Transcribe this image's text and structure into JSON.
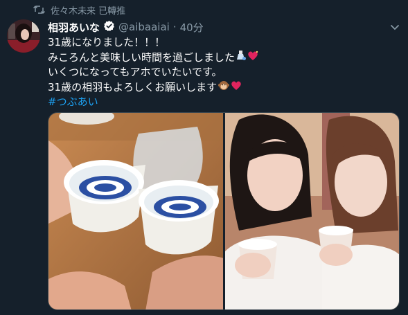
{
  "retweet": {
    "text": "佐々木未来 已轉推",
    "icon": "retweet-icon"
  },
  "author": {
    "display_name": "相羽あいな",
    "handle": "@aibaaiai",
    "separator": "·",
    "time": "40分",
    "verified_icon": "verified-badge-icon"
  },
  "tweet": {
    "lines": [
      "31歳になりました！！！",
      "みころんと美味しい時間を過ごしました",
      "いくつになってもアホでいたいです。",
      "31歳の相羽もよろしくお願いします"
    ],
    "hashtag": "#つぶあい"
  },
  "media": {
    "photos": [
      {
        "subject": "two sake cups toasting"
      },
      {
        "subject": "two women holding sake cups"
      }
    ]
  },
  "colors": {
    "background": "#15202b",
    "text": "#ffffff",
    "secondary": "#8899a6",
    "link": "#1da1f2",
    "border": "#38444d"
  }
}
